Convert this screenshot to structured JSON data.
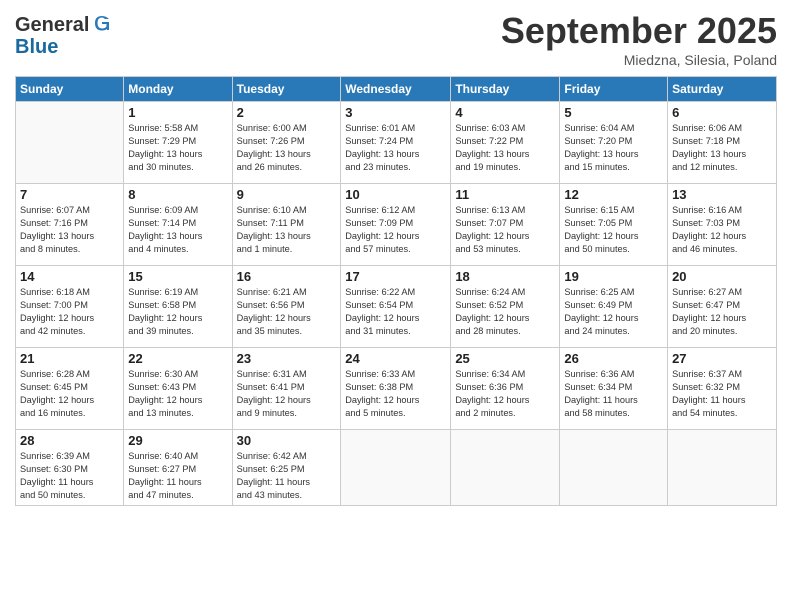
{
  "header": {
    "logo_line1": "General",
    "logo_line2": "Blue",
    "month": "September 2025",
    "location": "Miedzna, Silesia, Poland"
  },
  "weekdays": [
    "Sunday",
    "Monday",
    "Tuesday",
    "Wednesday",
    "Thursday",
    "Friday",
    "Saturday"
  ],
  "weeks": [
    [
      {
        "day": "",
        "info": ""
      },
      {
        "day": "1",
        "info": "Sunrise: 5:58 AM\nSunset: 7:29 PM\nDaylight: 13 hours\nand 30 minutes."
      },
      {
        "day": "2",
        "info": "Sunrise: 6:00 AM\nSunset: 7:26 PM\nDaylight: 13 hours\nand 26 minutes."
      },
      {
        "day": "3",
        "info": "Sunrise: 6:01 AM\nSunset: 7:24 PM\nDaylight: 13 hours\nand 23 minutes."
      },
      {
        "day": "4",
        "info": "Sunrise: 6:03 AM\nSunset: 7:22 PM\nDaylight: 13 hours\nand 19 minutes."
      },
      {
        "day": "5",
        "info": "Sunrise: 6:04 AM\nSunset: 7:20 PM\nDaylight: 13 hours\nand 15 minutes."
      },
      {
        "day": "6",
        "info": "Sunrise: 6:06 AM\nSunset: 7:18 PM\nDaylight: 13 hours\nand 12 minutes."
      }
    ],
    [
      {
        "day": "7",
        "info": "Sunrise: 6:07 AM\nSunset: 7:16 PM\nDaylight: 13 hours\nand 8 minutes."
      },
      {
        "day": "8",
        "info": "Sunrise: 6:09 AM\nSunset: 7:14 PM\nDaylight: 13 hours\nand 4 minutes."
      },
      {
        "day": "9",
        "info": "Sunrise: 6:10 AM\nSunset: 7:11 PM\nDaylight: 13 hours\nand 1 minute."
      },
      {
        "day": "10",
        "info": "Sunrise: 6:12 AM\nSunset: 7:09 PM\nDaylight: 12 hours\nand 57 minutes."
      },
      {
        "day": "11",
        "info": "Sunrise: 6:13 AM\nSunset: 7:07 PM\nDaylight: 12 hours\nand 53 minutes."
      },
      {
        "day": "12",
        "info": "Sunrise: 6:15 AM\nSunset: 7:05 PM\nDaylight: 12 hours\nand 50 minutes."
      },
      {
        "day": "13",
        "info": "Sunrise: 6:16 AM\nSunset: 7:03 PM\nDaylight: 12 hours\nand 46 minutes."
      }
    ],
    [
      {
        "day": "14",
        "info": "Sunrise: 6:18 AM\nSunset: 7:00 PM\nDaylight: 12 hours\nand 42 minutes."
      },
      {
        "day": "15",
        "info": "Sunrise: 6:19 AM\nSunset: 6:58 PM\nDaylight: 12 hours\nand 39 minutes."
      },
      {
        "day": "16",
        "info": "Sunrise: 6:21 AM\nSunset: 6:56 PM\nDaylight: 12 hours\nand 35 minutes."
      },
      {
        "day": "17",
        "info": "Sunrise: 6:22 AM\nSunset: 6:54 PM\nDaylight: 12 hours\nand 31 minutes."
      },
      {
        "day": "18",
        "info": "Sunrise: 6:24 AM\nSunset: 6:52 PM\nDaylight: 12 hours\nand 28 minutes."
      },
      {
        "day": "19",
        "info": "Sunrise: 6:25 AM\nSunset: 6:49 PM\nDaylight: 12 hours\nand 24 minutes."
      },
      {
        "day": "20",
        "info": "Sunrise: 6:27 AM\nSunset: 6:47 PM\nDaylight: 12 hours\nand 20 minutes."
      }
    ],
    [
      {
        "day": "21",
        "info": "Sunrise: 6:28 AM\nSunset: 6:45 PM\nDaylight: 12 hours\nand 16 minutes."
      },
      {
        "day": "22",
        "info": "Sunrise: 6:30 AM\nSunset: 6:43 PM\nDaylight: 12 hours\nand 13 minutes."
      },
      {
        "day": "23",
        "info": "Sunrise: 6:31 AM\nSunset: 6:41 PM\nDaylight: 12 hours\nand 9 minutes."
      },
      {
        "day": "24",
        "info": "Sunrise: 6:33 AM\nSunset: 6:38 PM\nDaylight: 12 hours\nand 5 minutes."
      },
      {
        "day": "25",
        "info": "Sunrise: 6:34 AM\nSunset: 6:36 PM\nDaylight: 12 hours\nand 2 minutes."
      },
      {
        "day": "26",
        "info": "Sunrise: 6:36 AM\nSunset: 6:34 PM\nDaylight: 11 hours\nand 58 minutes."
      },
      {
        "day": "27",
        "info": "Sunrise: 6:37 AM\nSunset: 6:32 PM\nDaylight: 11 hours\nand 54 minutes."
      }
    ],
    [
      {
        "day": "28",
        "info": "Sunrise: 6:39 AM\nSunset: 6:30 PM\nDaylight: 11 hours\nand 50 minutes."
      },
      {
        "day": "29",
        "info": "Sunrise: 6:40 AM\nSunset: 6:27 PM\nDaylight: 11 hours\nand 47 minutes."
      },
      {
        "day": "30",
        "info": "Sunrise: 6:42 AM\nSunset: 6:25 PM\nDaylight: 11 hours\nand 43 minutes."
      },
      {
        "day": "",
        "info": ""
      },
      {
        "day": "",
        "info": ""
      },
      {
        "day": "",
        "info": ""
      },
      {
        "day": "",
        "info": ""
      }
    ]
  ]
}
